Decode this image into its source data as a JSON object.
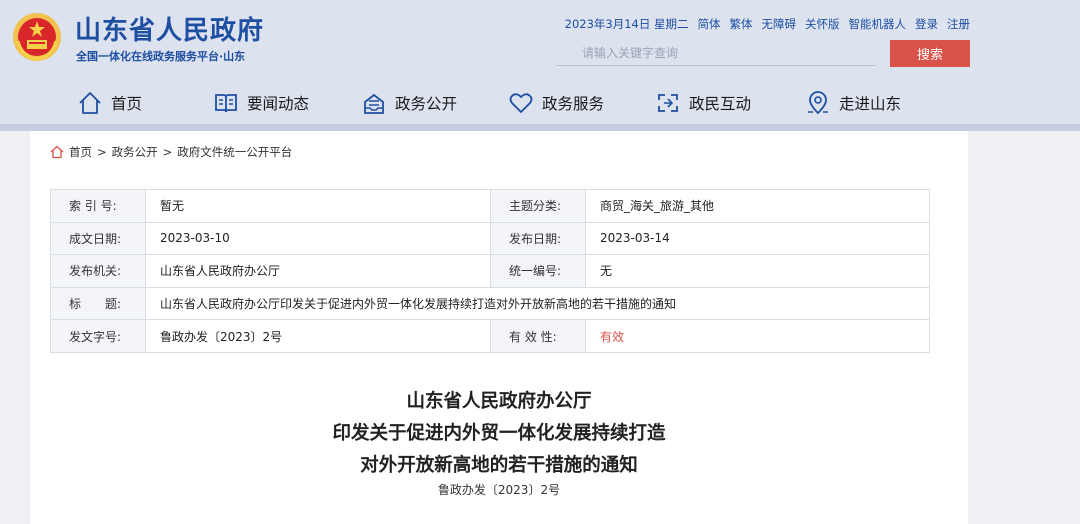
{
  "header": {
    "site_name": "山东省人民政府",
    "site_sub": "全国一体化在线政务服务平台·山东",
    "date": "2023年3月14日 星期二",
    "links": [
      "简体",
      "繁体",
      "无障碍",
      "关怀版",
      "智能机器人",
      "登录",
      "注册"
    ],
    "search_placeholder": "请输入关键字查询",
    "search_button": "搜索"
  },
  "nav": [
    {
      "label": "首页",
      "icon": "home-icon"
    },
    {
      "label": "要闻动态",
      "icon": "book-icon"
    },
    {
      "label": "政务公开",
      "icon": "inbox-icon"
    },
    {
      "label": "政务服务",
      "icon": "heart-icon"
    },
    {
      "label": "政民互动",
      "icon": "interact-icon"
    },
    {
      "label": "走进山东",
      "icon": "map-pin-icon"
    }
  ],
  "breadcrumb": [
    "首页",
    "政务公开",
    "政府文件统一公开平台"
  ],
  "meta": {
    "index_label": "索 引 号:",
    "index_value": "暂无",
    "topic_label": "主题分类:",
    "topic_value": "商贸_海关_旅游_其他",
    "date_label": "成文日期:",
    "date_value": "2023-03-10",
    "pub_label": "发布日期:",
    "pub_value": "2023-03-14",
    "org_label": "发布机关:",
    "org_value": "山东省人民政府办公厅",
    "serial_label": "统一编号:",
    "serial_value": "无",
    "title_label": "标　　题:",
    "title_value": "山东省人民政府办公厅印发关于促进内外贸一体化发展持续打造对外开放新高地的若干措施的通知",
    "docno_label": "发文字号:",
    "docno_value": "鲁政办发〔2023〕2号",
    "valid_label": "有 效 性:",
    "valid_value": "有效"
  },
  "document": {
    "title_line1": "山东省人民政府办公厅",
    "title_line2": "印发关于促进内外贸一体化发展持续打造",
    "title_line3": "对外开放新高地的若干措施的通知",
    "doc_number": "鲁政办发〔2023〕2号"
  },
  "colors": {
    "brand_blue": "#1e4fa3",
    "search_red": "#d9534a",
    "header_bg": "#dde3ee"
  }
}
